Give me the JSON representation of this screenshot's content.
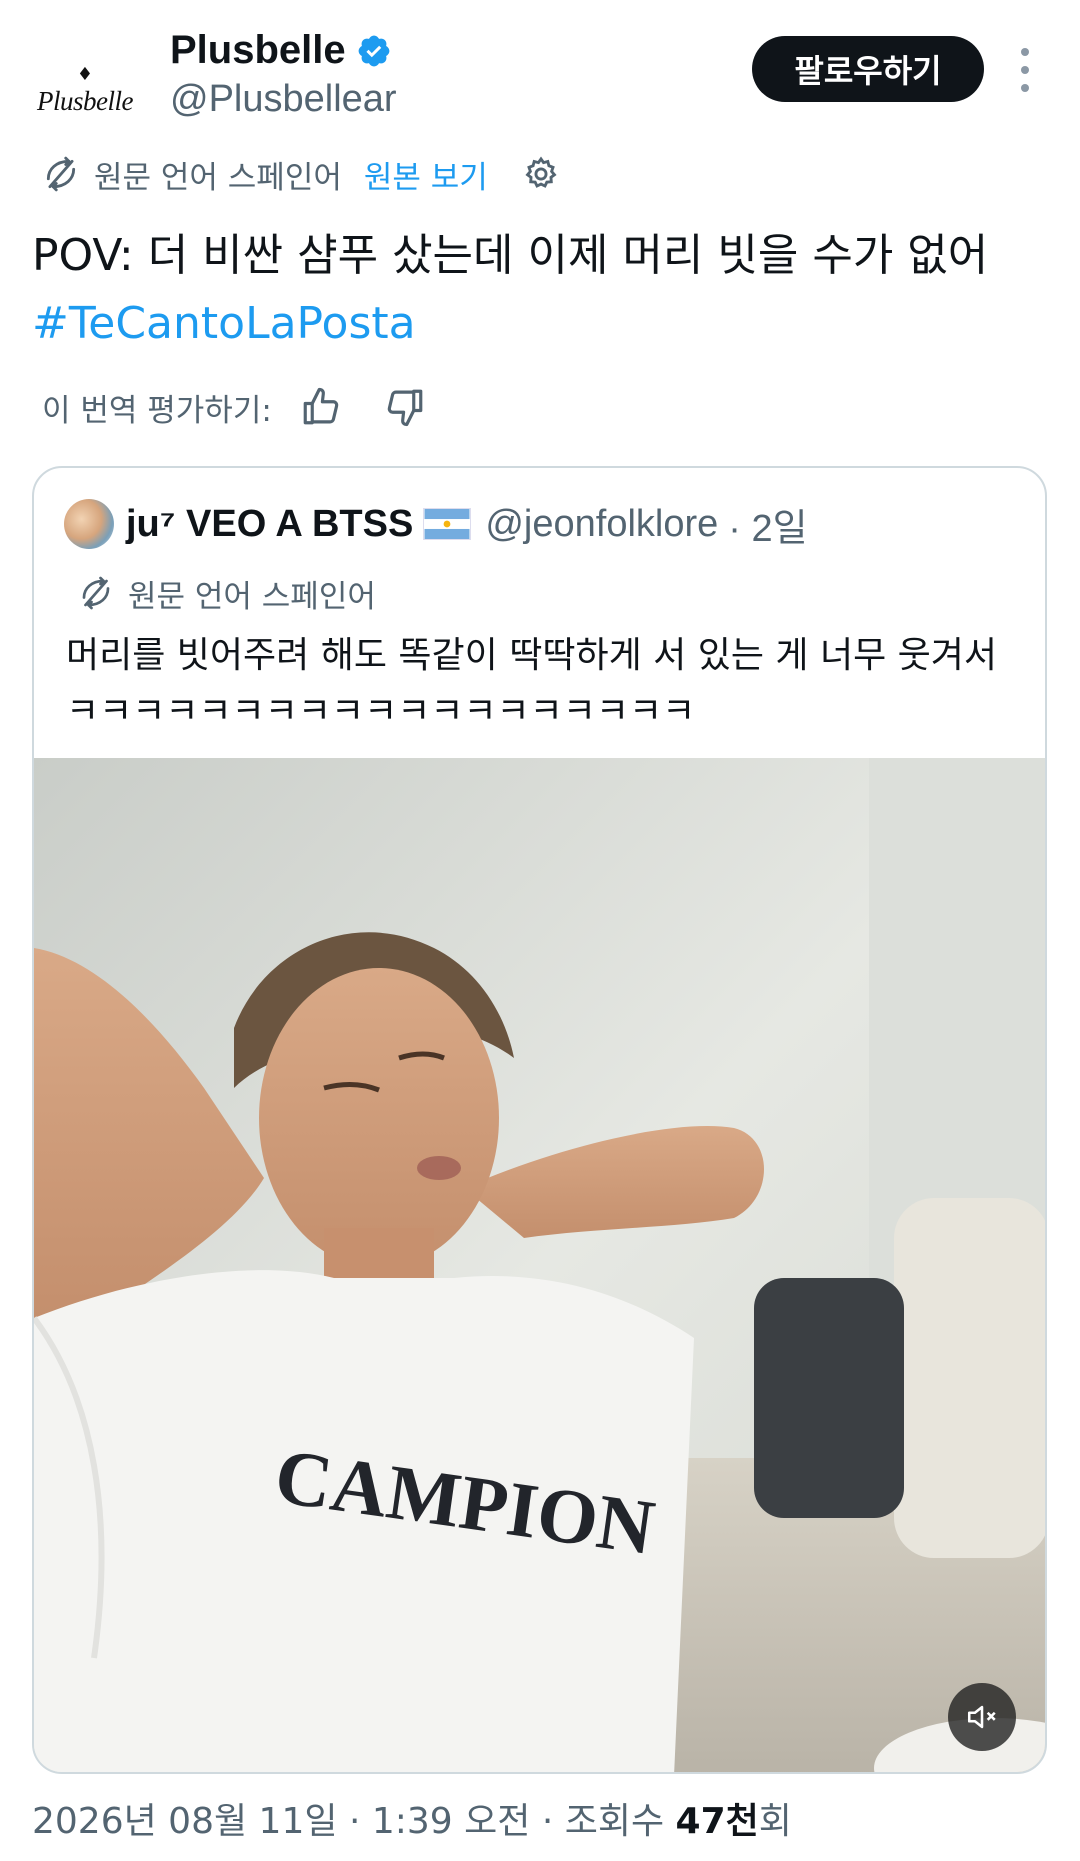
{
  "account": {
    "logo_text": "Plusbelle",
    "display_name": "Plusbelle",
    "handle": "@Plusbellear",
    "verified": true,
    "follow_label": "팔로우하기"
  },
  "translation": {
    "source_label": "원문 언어 스페인어",
    "show_original_label": "원본 보기"
  },
  "tweet": {
    "text": "POV: 더 비싼 샴푸 샀는데 이제 머리 빗을 수가 없어",
    "hashtag": "#TeCantoLaPosta"
  },
  "rating": {
    "label": "이 번역 평가하기:"
  },
  "quote": {
    "display_name": "ju⁷ VEO A BTSS",
    "handle": "@jeonfolklore",
    "time": "· 2일",
    "translation_label": "원문 언어 스페인어",
    "text": "머리를 빗어주려 해도 똑같이 딱딱하게 서 있는 게 너무 웃겨서 ㅋㅋㅋㅋㅋㅋㅋㅋㅋㅋㅋㅋㅋㅋㅋㅋㅋㅋㅋ",
    "shirt_text": "CAMPION"
  },
  "meta": {
    "date": "2026년 08월 11일",
    "time": "1:39 오전",
    "views_label": "조회수",
    "views_count": "47천",
    "views_suffix": "회"
  },
  "colors": {
    "accent": "#1d9bf0",
    "text": "#0f1419",
    "secondary": "#536471",
    "border": "#cfd9de"
  },
  "icons": [
    "verified-badge-icon",
    "more-icon",
    "translate-icon",
    "settings-gear-icon",
    "thumbs-up-icon",
    "thumbs-down-icon",
    "argentina-flag-icon",
    "muted-speaker-icon"
  ]
}
